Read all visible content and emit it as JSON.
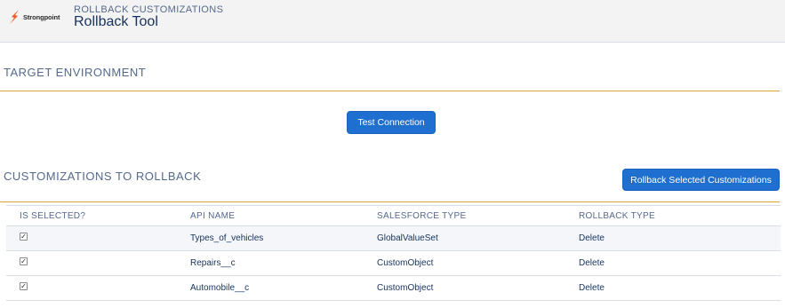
{
  "header": {
    "logo_text": "Strongpoint",
    "eyebrow": "ROLLBACK CUSTOMIZATIONS",
    "title": "Rollback Tool"
  },
  "target_section": {
    "title": "TARGET ENVIRONMENT",
    "test_button": "Test Connection"
  },
  "customizations_section": {
    "title": "CUSTOMIZATIONS TO ROLLBACK",
    "rollback_button": "Rollback Selected Customizations"
  },
  "table": {
    "columns": [
      "IS SELECTED?",
      "API NAME",
      "SALESFORCE TYPE",
      "ROLLBACK TYPE"
    ],
    "rows": [
      {
        "selected": true,
        "api_name": "Types_of_vehicles",
        "type": "GlobalValueSet",
        "rollback": "Delete"
      },
      {
        "selected": true,
        "api_name": "Repairs__c",
        "type": "CustomObject",
        "rollback": "Delete"
      },
      {
        "selected": true,
        "api_name": "Automobile__c",
        "type": "CustomObject",
        "rollback": "Delete"
      }
    ]
  },
  "colors": {
    "accent_rule": "#d9a23a",
    "button": "#1f6fd0",
    "logo_orange": "#e8612c"
  }
}
